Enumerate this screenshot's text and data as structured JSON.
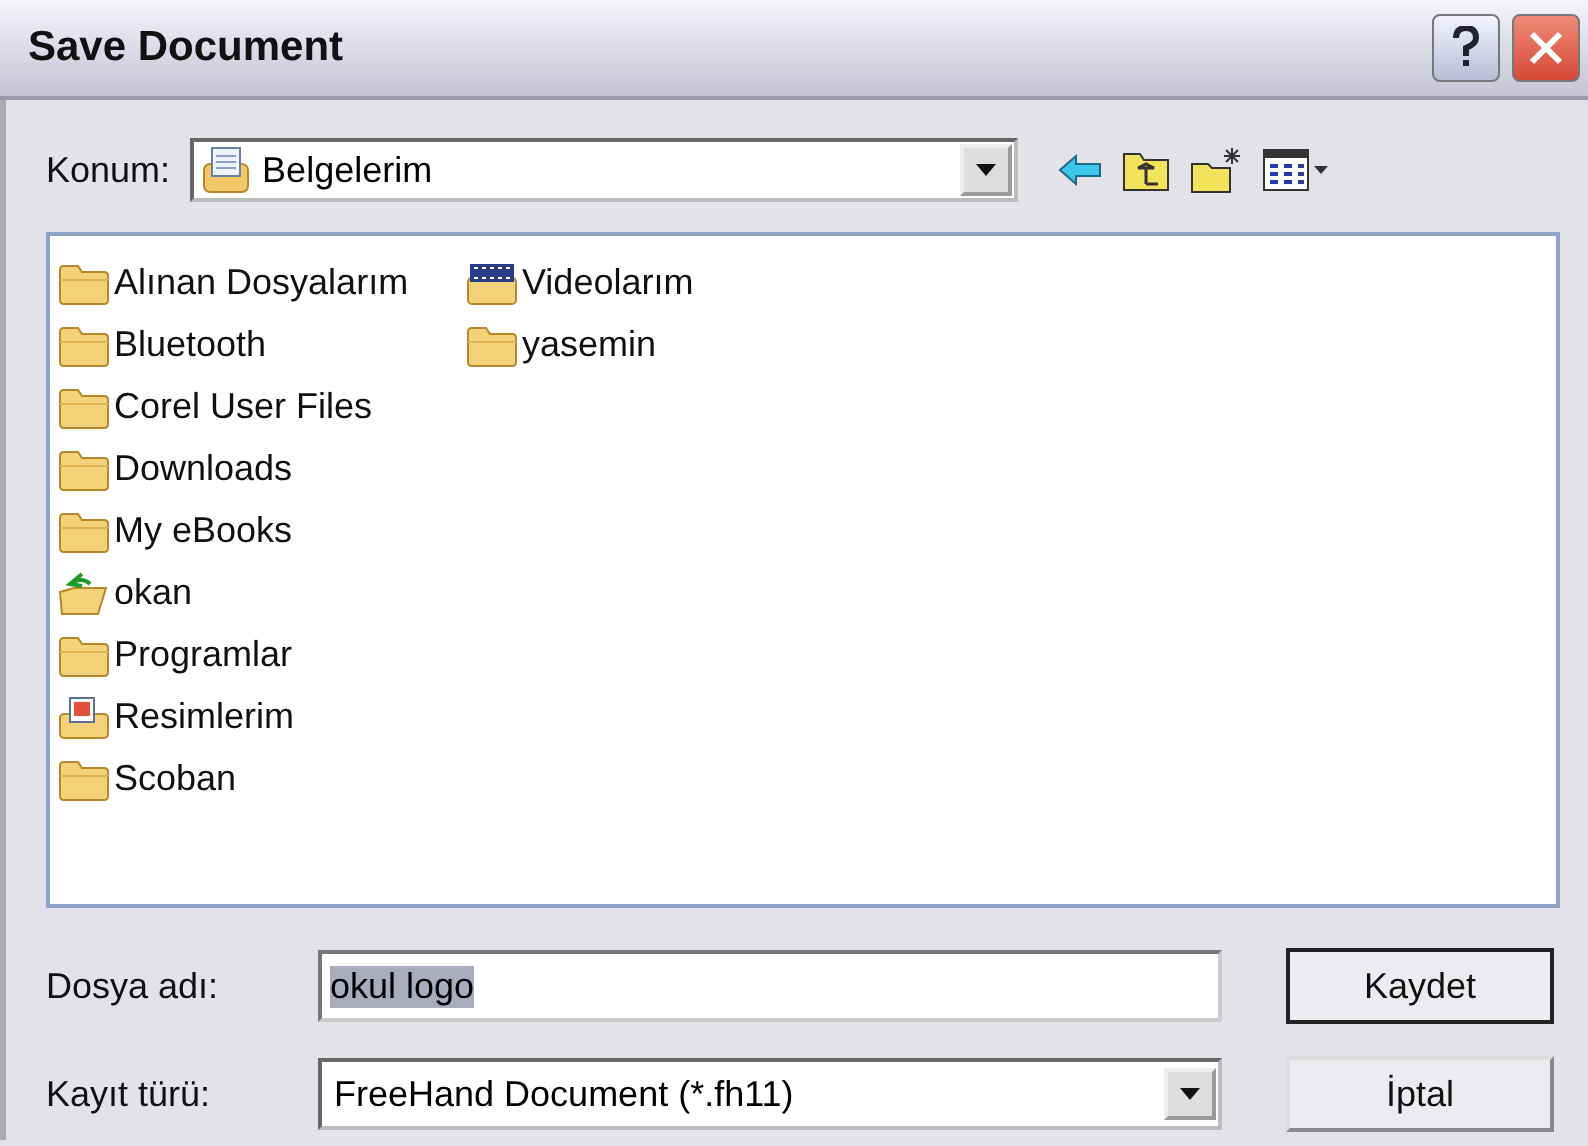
{
  "window": {
    "title": "Save Document"
  },
  "location": {
    "label": "Konum:",
    "value": "Belgelerim"
  },
  "files": [
    {
      "name": "Alınan Dosyalarım",
      "kind": "folder"
    },
    {
      "name": "Bluetooth",
      "kind": "folder"
    },
    {
      "name": "Corel User Files",
      "kind": "folder"
    },
    {
      "name": "Downloads",
      "kind": "folder"
    },
    {
      "name": "My eBooks",
      "kind": "folder"
    },
    {
      "name": "okan",
      "kind": "shared"
    },
    {
      "name": "Programlar",
      "kind": "folder"
    },
    {
      "name": "Resimlerim",
      "kind": "pictures"
    },
    {
      "name": "Scoban",
      "kind": "folder"
    },
    {
      "name": "Videolarım",
      "kind": "videos"
    },
    {
      "name": "yasemin",
      "kind": "folder"
    }
  ],
  "filename": {
    "label": "Dosya adı:",
    "value": "okul logo",
    "selected": true
  },
  "filetype": {
    "label": "Kayıt türü:",
    "value": "FreeHand Document (*.fh11)"
  },
  "buttons": [
    "Kaydet",
    "İptal"
  ]
}
